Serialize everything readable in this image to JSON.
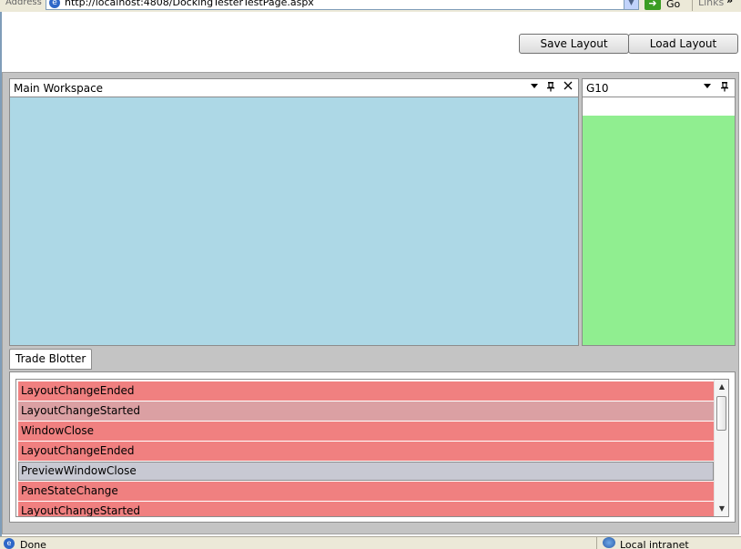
{
  "browser": {
    "address_label": "Address",
    "url": "http://localhost:4808/DockingTesterTestPage.aspx",
    "go_label": "Go",
    "links_label": "Links",
    "links_chevron": "»"
  },
  "toolbar": {
    "save_label": "Save Layout",
    "load_label": "Load Layout"
  },
  "panes": {
    "main": {
      "title": "Main Workspace",
      "color": "#add8e6"
    },
    "g10": {
      "title": "G10",
      "color": "#90ee90"
    }
  },
  "tabs": {
    "trade_blotter": "Trade Blotter"
  },
  "events": {
    "items": [
      {
        "label": "LayoutChangeEnded",
        "state": "normal"
      },
      {
        "label": "LayoutChangeStarted",
        "state": "hover"
      },
      {
        "label": "WindowClose",
        "state": "normal"
      },
      {
        "label": "LayoutChangeEnded",
        "state": "normal"
      },
      {
        "label": "PreviewWindowClose",
        "state": "selected"
      },
      {
        "label": "PaneStateChange",
        "state": "normal"
      },
      {
        "label": "LayoutChangeStarted",
        "state": "normal"
      }
    ],
    "item_color": "#f08080",
    "hover_color": "#dba0a3",
    "selected_color": "#c8c9d3"
  },
  "status": {
    "text": "Done",
    "zone": "Local intranet"
  }
}
